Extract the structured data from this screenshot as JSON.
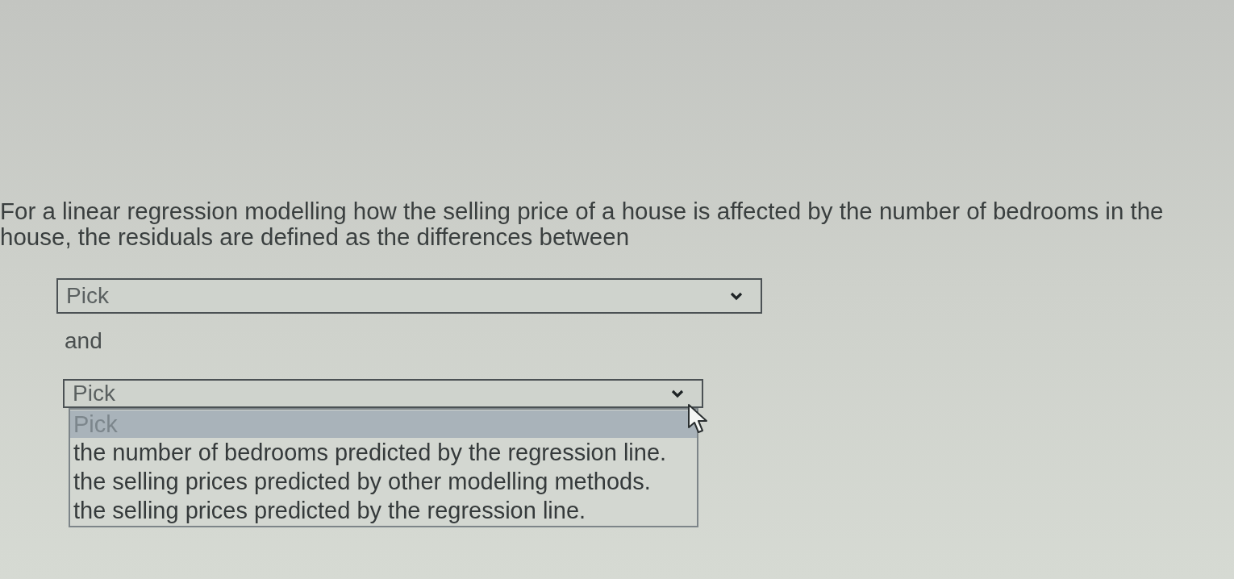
{
  "question": "For a linear regression modelling how the selling price of a house is affected by the number of bedrooms in the house, the residuals are defined as the differences between",
  "answer_parts": [
    {
      "kind": "select",
      "value": "Pick",
      "expanded": false
    },
    {
      "kind": "text",
      "text": "and"
    },
    {
      "kind": "select",
      "value": "Pick",
      "expanded": true,
      "options": [
        {
          "label": "Pick",
          "selected": true
        },
        {
          "label": "the number of bedrooms predicted by the regression line.",
          "selected": false
        },
        {
          "label": "the selling prices predicted by other modelling methods.",
          "selected": false
        },
        {
          "label": "the selling prices predicted by the regression line.",
          "selected": false
        }
      ]
    }
  ]
}
